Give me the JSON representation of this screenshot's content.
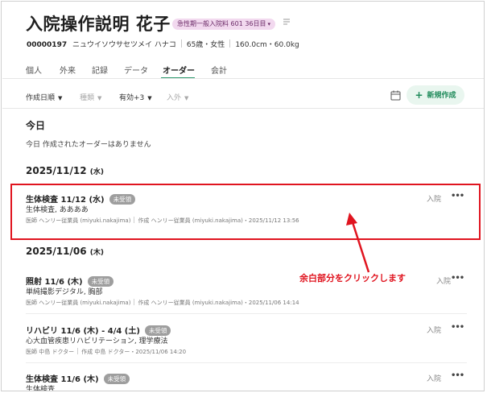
{
  "patient": {
    "name": "入院操作説明 花子",
    "admission_badge": "急性期一般入院料 601 36日目",
    "id": "00000197",
    "kana": "ニュウイソウサセツメイ ハナコ",
    "age_sex": "65歳・女性",
    "body": "160.0cm・60.0kg"
  },
  "tabs": [
    {
      "label": "個人",
      "active": false
    },
    {
      "label": "外来",
      "active": false
    },
    {
      "label": "記録",
      "active": false
    },
    {
      "label": "データ",
      "active": false
    },
    {
      "label": "オーダー",
      "active": true
    },
    {
      "label": "会計",
      "active": false
    }
  ],
  "filters": {
    "sort": "作成日順",
    "type": "種類",
    "validity": "有効+3",
    "inpatient": "入外"
  },
  "new_button_label": "新規作成",
  "sections": {
    "today_heading": "今日",
    "today_empty": "今日 作成されたオーダーはありません",
    "date1": "2025/11/12",
    "date1_day": "(水)",
    "date2": "2025/11/06",
    "date2_day": "(木)"
  },
  "orders": [
    {
      "title": "生体検査 11/12 (水)",
      "status": "未受領",
      "desc": "生体検査, ああああ",
      "doctor": "医師 ヘンリー従業員 (miyuki.nakajima)",
      "created": "作成 ヘンリー従業員 (miyuki.nakajima)・2025/11/12 13:56",
      "location": "入院"
    },
    {
      "title": "照射 11/6 (木)",
      "status": "未受領",
      "desc": "単純撮影デジタル, 胸部",
      "doctor": "医師 ヘンリー従業員 (miyuki.nakajima)",
      "created": "作成 ヘンリー従業員 (miyuki.nakajima)・2025/11/06 14:14",
      "location": "入院"
    },
    {
      "title": "リハビリ 11/6 (木) - 4/4 (土)",
      "status": "未受領",
      "desc": "心大血管疾患リハビリテーション, 理学療法",
      "doctor": "医師 中島 ドクター",
      "created": "作成 中島 ドクター・2025/11/06 14:20",
      "location": "入院"
    },
    {
      "title": "生体検査 11/6 (木)",
      "status": "未受領",
      "desc": "生体検査",
      "location": "入院"
    }
  ],
  "annotation": "余白部分をクリックします",
  "colors": {
    "accent": "#2e9b6f",
    "highlight": "#e0141f",
    "badge_bg": "#f2d9ef",
    "status_bg": "#9e9e9e"
  }
}
